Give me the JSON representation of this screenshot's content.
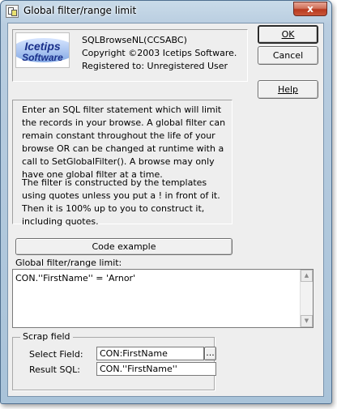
{
  "window": {
    "title": "Global filter/range limit",
    "close_glyph": "x"
  },
  "header": {
    "logo_line1": "Icetips",
    "logo_line2": "Software",
    "product": "SQLBrowseNL(CCSABC)",
    "copyright": "Copyright ©2003 Icetips Software.",
    "registered": "Registered to: Unregistered User"
  },
  "buttons": {
    "ok": "OK",
    "cancel": "Cancel",
    "help": "Help",
    "code_example": "Code example",
    "ellipsis": "..."
  },
  "description": {
    "para1": "Enter an SQL filter statement which will limit the records in your browse. A global filter can remain constant throughout the life of your browse OR can be changed at runtime with a call to SetGlobalFilter(). A browse may only have one global filter at a time.",
    "para2": "The filter is constructed by the templates using quotes unless you put a ! in front of it.  Then it is 100% up to you to construct it, including quotes."
  },
  "filter": {
    "label": "Global filter/range limit:",
    "value": "CON.''FirstName'' = 'Arnor'"
  },
  "scrap": {
    "caption": "Scrap field",
    "select_label": "Select Field:",
    "select_value": "CON:FirstName",
    "result_label": "Result SQL:",
    "result_value": "CON.''FirstName''"
  },
  "colors": {
    "frame": "#b9cde0",
    "dialog_bg": "#eeeeee",
    "close_button": "#c95639"
  },
  "icons": [
    "app-icon",
    "close-icon",
    "scroll-up-arrow-icon",
    "scroll-down-arrow-icon"
  ]
}
